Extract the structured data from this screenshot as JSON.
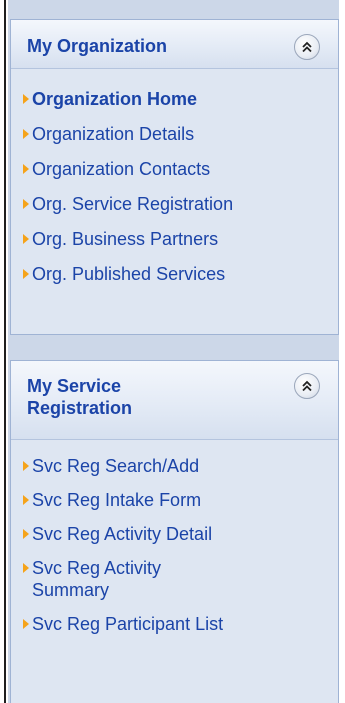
{
  "panels": [
    {
      "title": "My Organization",
      "collapse_icon": "double-chevron-up-icon",
      "links": [
        {
          "label": "Organization Home",
          "active": true
        },
        {
          "label": "Organization Details",
          "active": false
        },
        {
          "label": "Organization Contacts",
          "active": false
        },
        {
          "label": "Org. Service Registration",
          "active": false
        },
        {
          "label": "Org. Business Partners",
          "active": false
        },
        {
          "label": "Org. Published Services",
          "active": false
        }
      ]
    },
    {
      "title": "My Service Registration",
      "collapse_icon": "double-chevron-up-icon",
      "links": [
        {
          "label": "Svc Reg Search/Add",
          "active": false
        },
        {
          "label": "Svc Reg Intake Form",
          "active": false
        },
        {
          "label": "Svc Reg Activity Detail",
          "active": false
        },
        {
          "label": "Svc Reg Activity Summary",
          "active": false
        },
        {
          "label": "Svc Reg Participant List",
          "active": false
        }
      ]
    }
  ],
  "colors": {
    "link": "#1b44a8",
    "bullet": "#f5a31a",
    "panel_bg": "#dee6f2",
    "column_bg": "#ccd7e8"
  }
}
